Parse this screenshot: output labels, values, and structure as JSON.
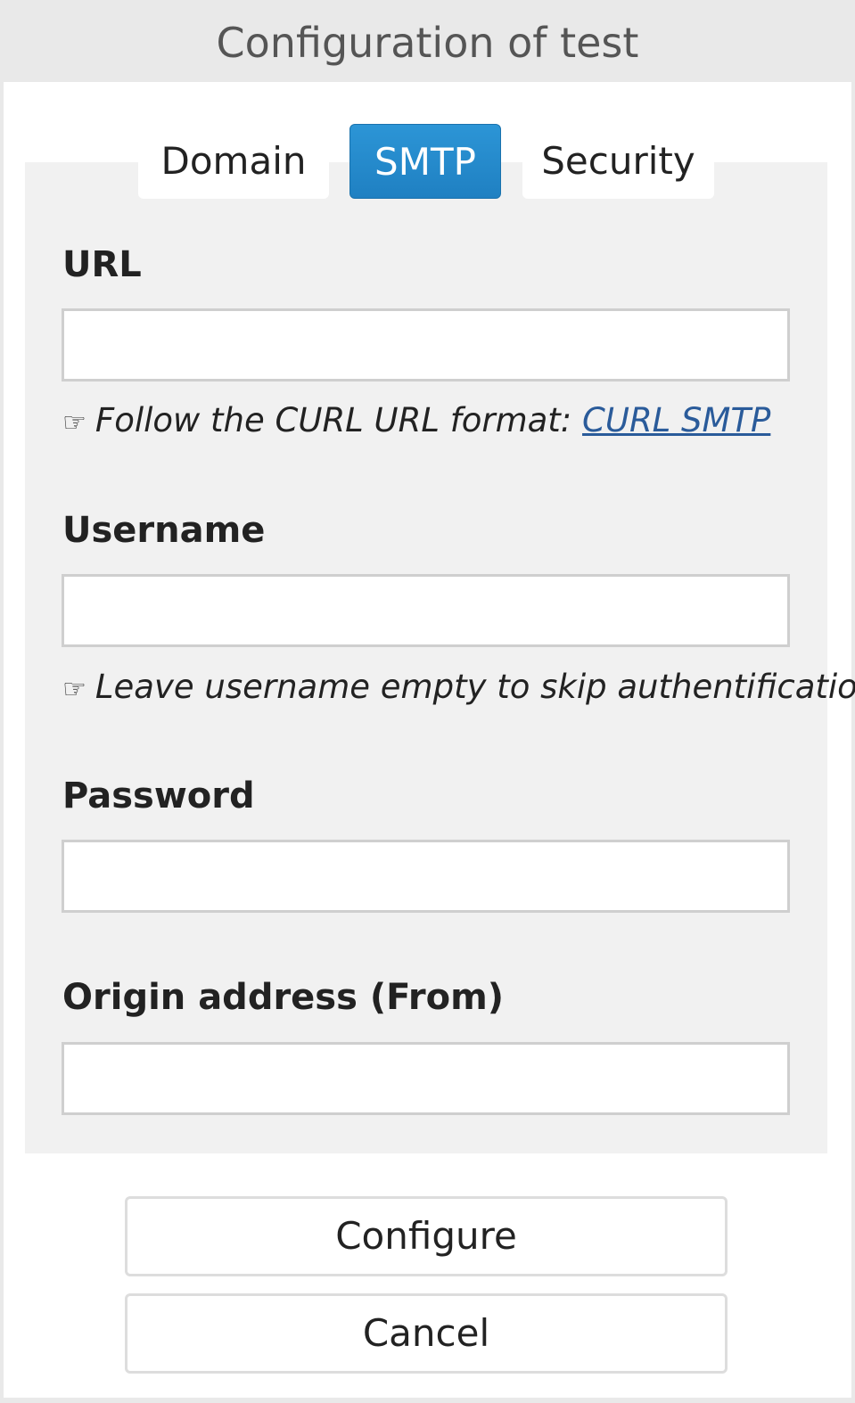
{
  "dialog": {
    "title": "Configuration of test"
  },
  "tabs": [
    {
      "label": "Domain",
      "active": false
    },
    {
      "label": "SMTP",
      "active": true
    },
    {
      "label": "Security",
      "active": false
    }
  ],
  "form": {
    "url": {
      "label": "URL",
      "value": "",
      "hint_icon": "☞",
      "hint_text": "Follow the CURL URL format: ",
      "hint_link": "CURL SMTP"
    },
    "username": {
      "label": "Username",
      "value": "",
      "hint_icon": "☞",
      "hint_text": "Leave username empty to skip authentification"
    },
    "password": {
      "label": "Password",
      "value": ""
    },
    "origin": {
      "label": "Origin address (From)",
      "value": ""
    }
  },
  "actions": {
    "configure_label": "Configure",
    "cancel_label": "Cancel"
  },
  "colors": {
    "active_tab": "#1f80c2",
    "link": "#2a5b9a",
    "panel_bg": "#f1f1f1"
  }
}
